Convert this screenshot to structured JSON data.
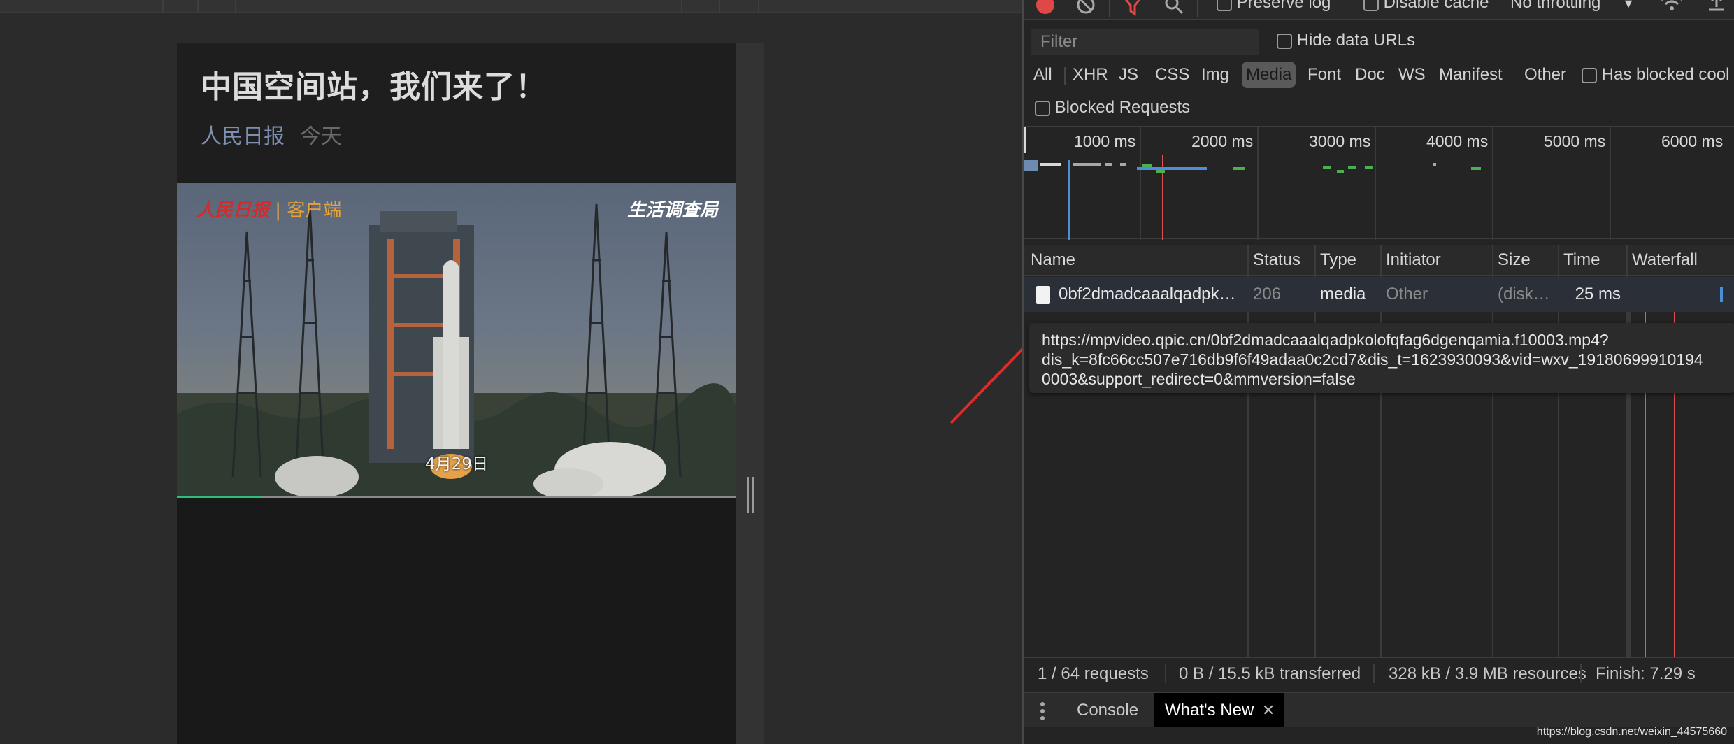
{
  "article": {
    "title": "中国空间站，我们来了！",
    "source": "人民日报",
    "date": "今天"
  },
  "video": {
    "caption": "4月29日",
    "watermark_left_brand": "人民日报",
    "watermark_left_label": "客户端",
    "watermark_right": "生活调查局",
    "progress_fraction": 0.15,
    "colors": {
      "progress": "#2bbf7a"
    }
  },
  "devtools": {
    "toolbar": {
      "preserve_log": "Preserve log",
      "disable_cache": "Disable cache",
      "throttling": "No throttling"
    },
    "filter": {
      "placeholder": "Filter",
      "hide_data_urls": "Hide data URLs"
    },
    "types": [
      "All",
      "XHR",
      "JS",
      "CSS",
      "Img",
      "Media",
      "Font",
      "Doc",
      "WS",
      "Manifest",
      "Other"
    ],
    "active_type": "Media",
    "has_blocked_cookies": "Has blocked cool",
    "blocked_requests": "Blocked Requests",
    "overview_ticks": [
      "1000 ms",
      "2000 ms",
      "3000 ms",
      "4000 ms",
      "5000 ms",
      "6000 ms"
    ],
    "columns": [
      "Name",
      "Status",
      "Type",
      "Initiator",
      "Size",
      "Time",
      "Waterfall"
    ],
    "rows": [
      {
        "name": "0bf2dmadcaaalqadpk…",
        "status": "206",
        "type": "media",
        "initiator": "Other",
        "size": "(disk…",
        "time": "25 ms"
      }
    ],
    "tooltip_lines": [
      "https://mpvideo.qpic.cn/0bf2dmadcaaalqadpkolofqfag6dgenqamia.f10003.mp4?",
      "dis_k=8fc66cc507e716db9f6f49adaa0c2cd7&dis_t=1623930093&vid=wxv_19180699910194",
      "0003&support_redirect=0&mmversion=false"
    ],
    "status_bar": {
      "requests": "1 / 64 requests",
      "transferred": "0 B / 15.5 kB transferred",
      "resources": "328 kB / 3.9 MB resources",
      "finish": "Finish: 7.29 s"
    },
    "drawer": {
      "console": "Console",
      "whats_new": "What's New"
    }
  },
  "watermark_url": "https://blog.csdn.net/weixin_44575660"
}
